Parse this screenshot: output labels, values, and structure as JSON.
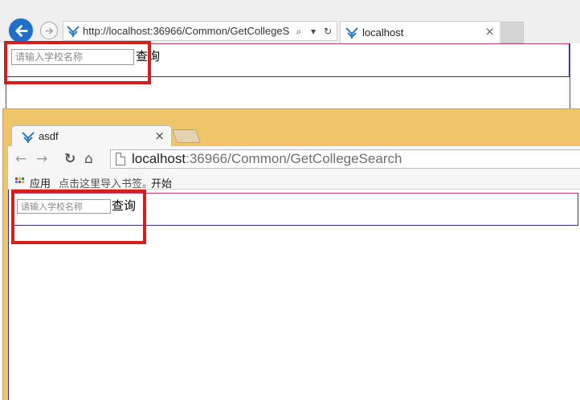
{
  "ie_window": {
    "address_url": "http://localhost:36966/Common/GetCollegeS",
    "tab_title": "localhost",
    "tab_close": "×",
    "address_icons": {
      "search": "⌕",
      "dropdown": "▾",
      "refresh": "↻"
    }
  },
  "ie_page": {
    "search_placeholder": "请输入学校名称",
    "query_button": "查询"
  },
  "chrome_window": {
    "tab_title": "asdf",
    "tab_close": "×",
    "url_host": "localhost",
    "url_rest": ":36966/Common/GetCollegeSearch",
    "bookmarks": {
      "apps": "应用",
      "import": "点击这里导入书签。",
      "start": "开始"
    }
  },
  "chrome_page": {
    "search_placeholder": "请输入学校名称",
    "query_button": "查询"
  },
  "colors": {
    "highlight": "#d51e1e",
    "ie_back": "#1f6fc4",
    "chrome_frame": "#efc56a",
    "form_border": "#3a2a8e"
  },
  "icons": {
    "back": "back-arrow-icon",
    "forward": "forward-arrow-icon",
    "site": "site-favicon-icon",
    "reload": "reload-icon",
    "home": "home-icon",
    "page": "page-icon",
    "apps": "apps-grid-icon"
  }
}
